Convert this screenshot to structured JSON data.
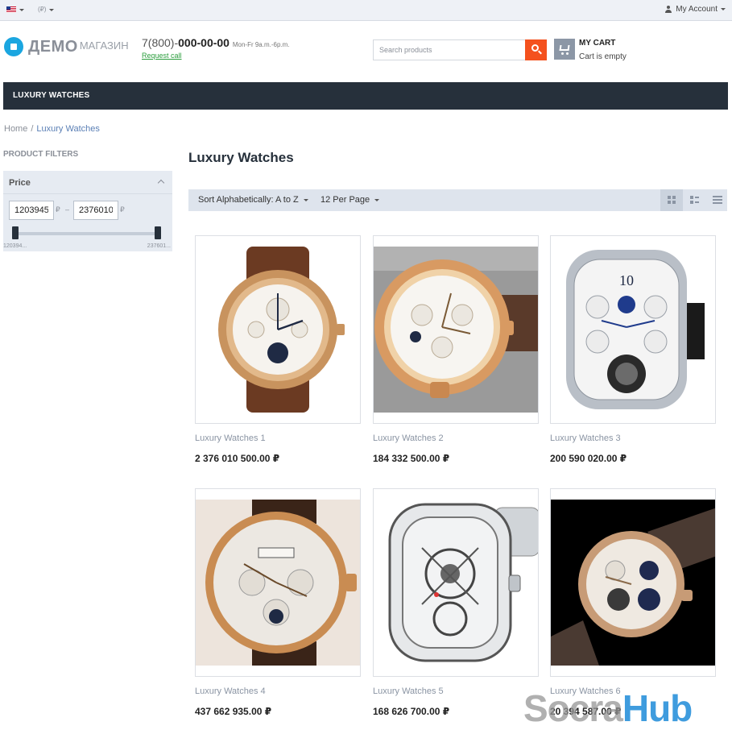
{
  "topbar": {
    "currency": "(₽)",
    "account": "My Account"
  },
  "header": {
    "logo_main": "ДЕМО",
    "logo_sub": "МАГАЗИН",
    "phone_prefix": "7(800)-",
    "phone_number": "000-00-00",
    "phone_hours": "Mon-Fr 9a.m.-6p.m.",
    "request_call": "Request call",
    "search_placeholder": "Search products",
    "cart_title": "MY CART",
    "cart_status": "Cart is empty"
  },
  "nav": {
    "items": [
      {
        "label": "LUXURY WATCHES"
      }
    ]
  },
  "breadcrumb": {
    "home": "Home",
    "separator": "/",
    "current": "Luxury Watches"
  },
  "sidebar": {
    "title": "PRODUCT FILTERS",
    "price": {
      "label": "Price",
      "min_value": "1203945",
      "max_value": "2376010",
      "currency": "₽",
      "dash": "–",
      "range_min_label": "120394...",
      "range_max_label": "237601..."
    }
  },
  "main": {
    "title": "Luxury Watches",
    "sort_label": "Sort Alphabetically: A to Z",
    "per_page_label": "12 Per Page"
  },
  "products": [
    {
      "name": "Luxury Watches 1",
      "price": "2 376 010 500.00 ₽"
    },
    {
      "name": "Luxury Watches 2",
      "price": "184 332 500.00 ₽"
    },
    {
      "name": "Luxury Watches 3",
      "price": "200 590 020.00 ₽"
    },
    {
      "name": "Luxury Watches 4",
      "price": "437 662 935.00 ₽"
    },
    {
      "name": "Luxury Watches 5",
      "price": "168 626 700.00 ₽"
    },
    {
      "name": "Luxury Watches 6",
      "price": "20 394 587.00 ₽"
    }
  ],
  "watermark": {
    "part1": "Socra",
    "part2": "Hub"
  },
  "colors": {
    "accent": "#f4511e",
    "nav_bg": "#26303b",
    "link": "#5a7fb5",
    "brand": "#1ba6e0",
    "request_call": "#2a9d3c"
  }
}
